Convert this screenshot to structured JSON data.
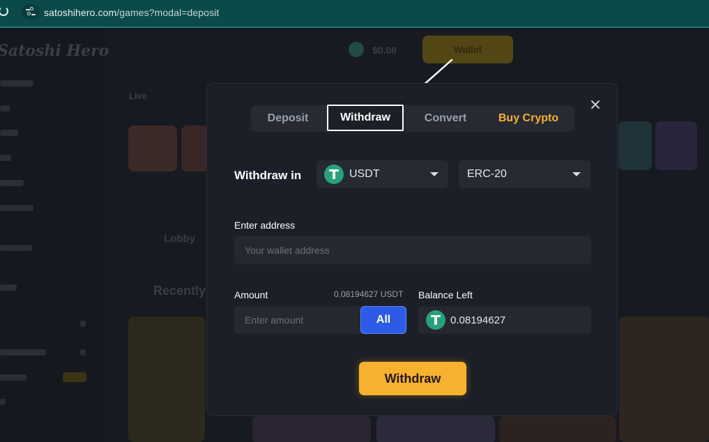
{
  "browser": {
    "url_host": "satoshihero.com",
    "url_path": "/games?modal=deposit"
  },
  "background": {
    "logo": "Satoshi Hero",
    "balance": "$0.08",
    "wallet_label": "Wallet",
    "live_label": "Live",
    "lobby_label": "Lobby",
    "recently_label": "Recently"
  },
  "modal": {
    "tabs": [
      {
        "label": "Deposit"
      },
      {
        "label": "Withdraw"
      },
      {
        "label": "Convert"
      },
      {
        "label": "Buy Crypto"
      }
    ],
    "active_tab": "Withdraw",
    "withdraw_in_label": "Withdraw in",
    "currency": "USDT",
    "network": "ERC-20",
    "address_label": "Enter address",
    "address_placeholder": "Your wallet address",
    "amount_label": "Amount",
    "amount_available": "0.08194627 USDT",
    "amount_placeholder": "Enter amount",
    "all_button": "All",
    "balance_left_label": "Balance Left",
    "balance_left_value": "0.08194627",
    "submit_button": "Withdraw"
  },
  "colors": {
    "accent": "#f6b12e",
    "all_button": "#2d5be8",
    "tether": "#26a17b"
  },
  "icons": {
    "close": "close-icon",
    "currency": "tether-icon",
    "dropdown": "chevron-down-icon"
  }
}
